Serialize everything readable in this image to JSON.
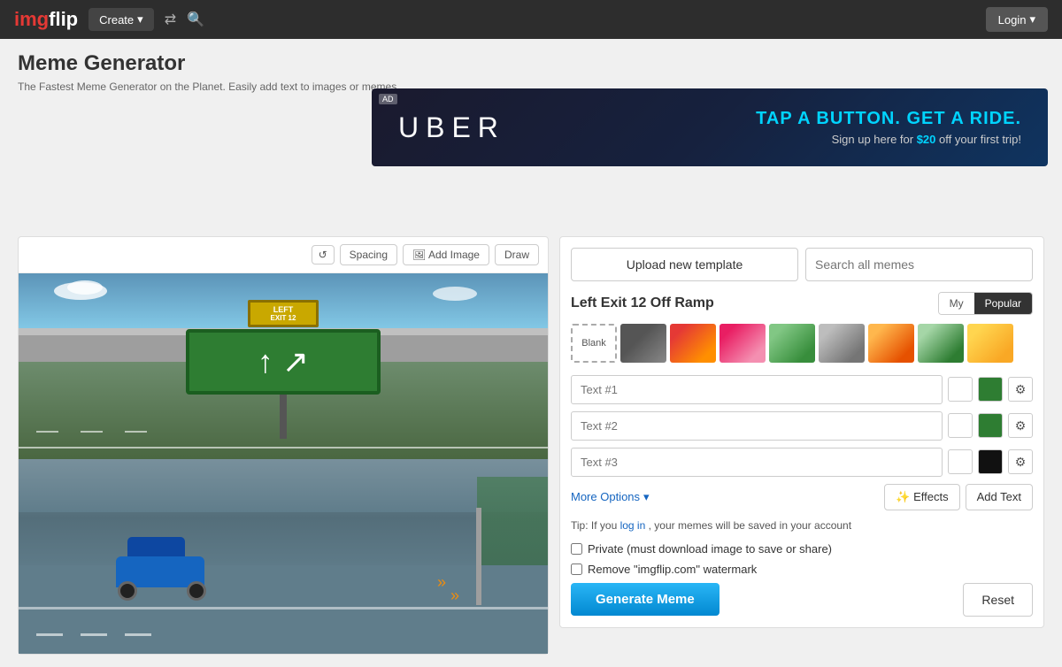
{
  "navbar": {
    "logo": "imgflip",
    "logo_accent": "img",
    "create_label": "Create",
    "login_label": "Login"
  },
  "page": {
    "title": "Meme Generator",
    "subtitle": "The Fastest Meme Generator on the Planet. Easily\nadd text to images or memes."
  },
  "ad": {
    "tag": "AD",
    "brand": "UBER",
    "headline": "TAP A BUTTON. GET A RIDE.",
    "subtext_before": "Sign up here for ",
    "highlight": "$20",
    "subtext_after": " off your first trip!"
  },
  "toolbar": {
    "spacing_label": "Spacing",
    "add_image_label": "Add Image",
    "draw_label": "Draw"
  },
  "right_panel": {
    "upload_label": "Upload new template",
    "search_placeholder": "Search all memes",
    "meme_title": "Left Exit 12 Off Ramp",
    "tabs": {
      "my_label": "My",
      "popular_label": "Popular"
    },
    "thumb_blank": "Blank",
    "text_fields": [
      {
        "placeholder": "Text #1"
      },
      {
        "placeholder": "Text #2"
      },
      {
        "placeholder": "Text #3"
      }
    ],
    "more_options_label": "More Options",
    "effects_label": "Effects",
    "add_text_label": "Add Text",
    "tip_text": "Tip: If you ",
    "tip_link": "log in",
    "tip_suffix": ", your memes will be saved in your account",
    "private_label": "Private (must download image to save or share)",
    "watermark_label": "Remove \"imgflip.com\" watermark",
    "generate_label": "Generate Meme",
    "reset_label": "Reset"
  }
}
